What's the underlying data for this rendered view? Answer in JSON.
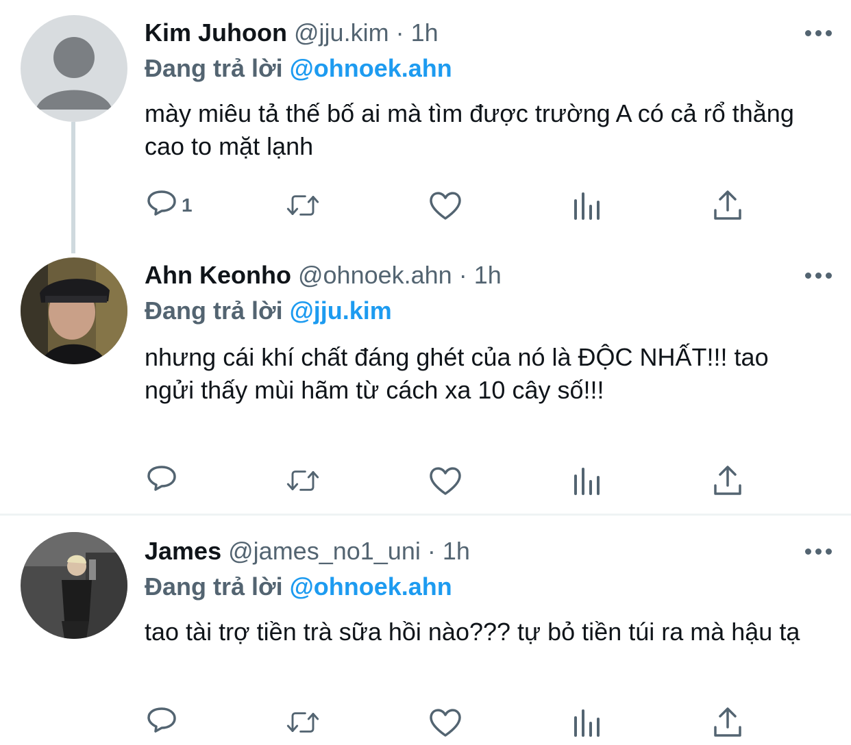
{
  "tweets": [
    {
      "name": "Kim Juhoon",
      "handle": "@jju.kim",
      "dot": "·",
      "time": "1h",
      "replying_label": "Đang trả lời",
      "replying_to": "@ohnoek.ahn",
      "text": "mày miêu tả thế bố ai mà tìm được trường A có cả rổ thằng cao to mặt lạnh",
      "reply_count": "1"
    },
    {
      "name": "Ahn Keonho",
      "handle": "@ohnoek.ahn",
      "dot": "·",
      "time": "1h",
      "replying_label": "Đang trả lời",
      "replying_to": "@jju.kim",
      "text": "nhưng cái khí chất đáng ghét của nó là ĐỘC NHẤT!!! tao ngửi thấy mùi hãm từ cách xa 10 cây số!!!",
      "reply_count": ""
    },
    {
      "name": "James",
      "handle": "@james_no1_uni",
      "dot": "·",
      "time": "1h",
      "replying_label": "Đang trả lời",
      "replying_to": "@ohnoek.ahn",
      "text": "tao tài trợ tiền trà sữa hồi nào??? tự bỏ tiền túi ra mà hậu tạ",
      "reply_count": ""
    }
  ],
  "icons": {
    "reply": "reply-icon",
    "retweet": "retweet-icon",
    "like": "heart-icon",
    "analytics": "analytics-icon",
    "share": "share-icon",
    "more": "more-icon"
  },
  "colors": {
    "mention": "#1d9bf0",
    "secondary": "#536471",
    "text": "#0f1419",
    "thread_line": "#cfd9de"
  }
}
